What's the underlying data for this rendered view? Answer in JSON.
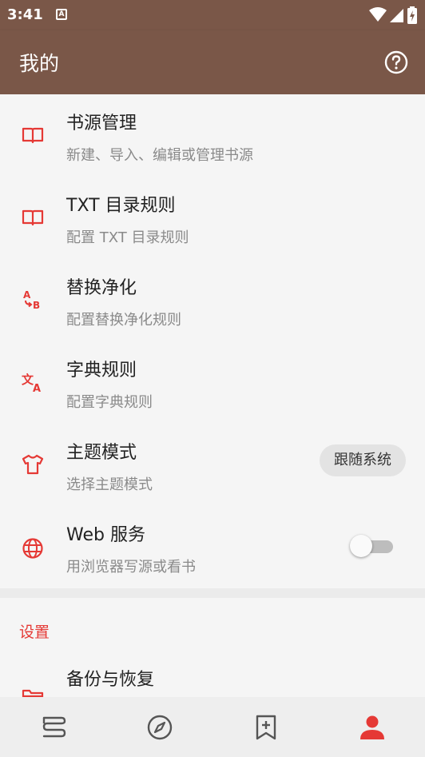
{
  "status_bar": {
    "time": "3:41",
    "notification_badge": "A"
  },
  "app_bar": {
    "title": "我的",
    "help_icon": "help-circle-icon"
  },
  "main_items": [
    {
      "icon": "book-open-icon",
      "title": "书源管理",
      "subtitle": "新建、导入、编辑或管理书源"
    },
    {
      "icon": "book-open-icon",
      "title": "TXT 目录规则",
      "subtitle": "配置 TXT 目录规则"
    },
    {
      "icon": "replace-ab-icon",
      "title": "替换净化",
      "subtitle": "配置替换净化规则"
    },
    {
      "icon": "translate-icon",
      "title": "字典规则",
      "subtitle": "配置字典规则"
    },
    {
      "icon": "tshirt-icon",
      "title": "主题模式",
      "subtitle": "选择主题模式",
      "chip": "跟随系统"
    },
    {
      "icon": "globe-icon",
      "title": "Web 服务",
      "subtitle": "用浏览器写源或看书",
      "switch_on": false
    }
  ],
  "settings_section": {
    "header": "设置",
    "items": [
      {
        "icon": "folder-icon",
        "title": "备份与恢复"
      }
    ]
  },
  "bottom_nav": [
    {
      "icon": "bookshelf-icon",
      "active": false
    },
    {
      "icon": "compass-icon",
      "active": false
    },
    {
      "icon": "bookmark-add-icon",
      "active": false
    },
    {
      "icon": "person-icon",
      "active": true
    }
  ],
  "colors": {
    "primary": "#7a5748",
    "accent": "#e53935",
    "icon_inactive": "#555555"
  }
}
